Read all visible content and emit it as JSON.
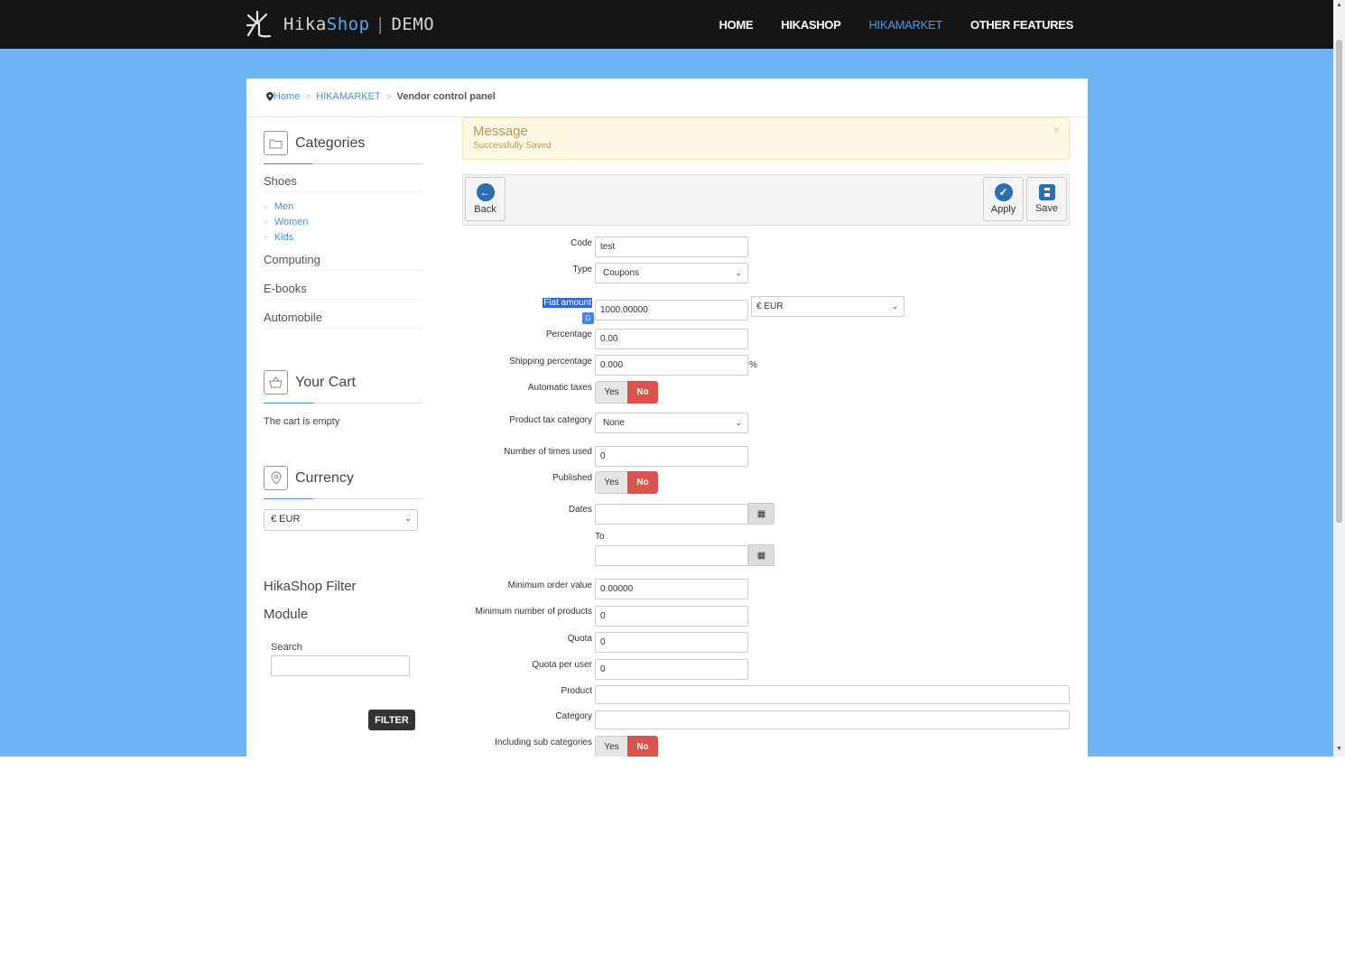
{
  "header": {
    "logo_text_1": "Hika",
    "logo_text_2": "Shop",
    "logo_sep": "|",
    "logo_text_3": "DEMO",
    "nav": [
      "HOME",
      "HIKASHOP",
      "HIKAMARKET",
      "OTHER FEATURES"
    ],
    "nav_active": "HIKAMARKET"
  },
  "breadcrumb": {
    "home": "Home",
    "level1": "HIKAMARKET",
    "current": "Vendor control panel"
  },
  "sidebar": {
    "categories_title": "Categories",
    "categories": [
      {
        "label": "Shoes",
        "children": [
          "Men",
          "Women",
          "Kids"
        ]
      },
      {
        "label": "Computing"
      },
      {
        "label": "E-books"
      },
      {
        "label": "Automobile"
      }
    ],
    "cart_title": "Your Cart",
    "cart_text": "The cart is empty",
    "currency_title": "Currency",
    "currency_value": "€ EUR",
    "filter_title_1": "HikaShop Filter",
    "filter_title_2": "Module",
    "filter_search_label": "Search",
    "filter_button": "FILTER"
  },
  "message": {
    "title": "Message",
    "text": "Successfully Saved",
    "close": "×"
  },
  "toolbar": {
    "back": "Back",
    "apply": "Apply",
    "save": "Save"
  },
  "form": {
    "code_label": "Code",
    "code_value": "test",
    "type_label": "Type",
    "type_value": "Coupons",
    "flat_label": "Flat amount",
    "flat_value": "1000.00000",
    "flat_currency": "€ EUR",
    "percentage_label": "Percentage",
    "percentage_value": "0.00",
    "shipping_label": "Shipping percentage",
    "shipping_value": "0.000",
    "shipping_unit": "%",
    "autotax_label": "Automatic taxes",
    "taxcat_label": "Product tax category",
    "taxcat_value": "None",
    "used_label": "Number of times used",
    "used_value": "0",
    "published_label": "Published",
    "dates_label": "Dates",
    "to_label": "To",
    "minorder_label": "Minimum order value",
    "minorder_value": "0.00000",
    "minprod_label": "Minimum number of products",
    "minprod_value": "0",
    "quota_label": "Quota",
    "quota_value": "0",
    "quotauser_label": "Quota per user",
    "quotauser_value": "0",
    "product_label": "Product",
    "category_label": "Category",
    "subcat_label": "Including sub categories",
    "yes": "Yes",
    "no": "No"
  }
}
